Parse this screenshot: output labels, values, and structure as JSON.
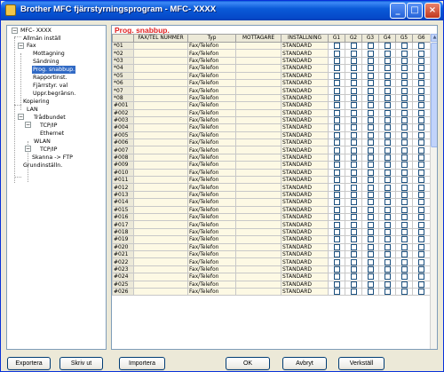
{
  "window": {
    "title": "Brother MFC fjärrstyrningsprogram - MFC-   XXXX"
  },
  "tree": {
    "items": [
      {
        "label": "MFC- XXXX"
      },
      {
        "label": "Allmän inställ"
      },
      {
        "label": "Fax"
      },
      {
        "label": "Mottagning"
      },
      {
        "label": "Sändning"
      },
      {
        "label": "Prog. snabbup."
      },
      {
        "label": "Rapportinst."
      },
      {
        "label": "Fjärrstyr. val"
      },
      {
        "label": "Uppr.begränsn."
      },
      {
        "label": "Kopiering"
      },
      {
        "label": "LAN"
      },
      {
        "label": "Trådbundet"
      },
      {
        "label": "TCP/IP"
      },
      {
        "label": "Ethernet"
      },
      {
        "label": "WLAN"
      },
      {
        "label": "TCP/IP"
      },
      {
        "label": "Skanna -> FTP"
      },
      {
        "label": "Grundinställn."
      }
    ],
    "selected": "Prog. snabbup."
  },
  "main": {
    "section_title": "Prog. snabbup.",
    "columns": [
      "",
      "FAX/TEL NUMMER",
      "Typ",
      "MOTTAGARE",
      "INSTÄLLNING",
      "G1",
      "G2",
      "G3",
      "G4",
      "G5",
      "G6"
    ],
    "rows": [
      {
        "id": "*01",
        "number": "",
        "type": "Fax/Telefon",
        "recipient": "",
        "setting": "STANDARD"
      },
      {
        "id": "*02",
        "number": "",
        "type": "Fax/Telefon",
        "recipient": "",
        "setting": "STANDARD"
      },
      {
        "id": "*03",
        "number": "",
        "type": "Fax/Telefon",
        "recipient": "",
        "setting": "STANDARD"
      },
      {
        "id": "*04",
        "number": "",
        "type": "Fax/Telefon",
        "recipient": "",
        "setting": "STANDARD"
      },
      {
        "id": "*05",
        "number": "",
        "type": "Fax/Telefon",
        "recipient": "",
        "setting": "STANDARD"
      },
      {
        "id": "*06",
        "number": "",
        "type": "Fax/Telefon",
        "recipient": "",
        "setting": "STANDARD"
      },
      {
        "id": "*07",
        "number": "",
        "type": "Fax/Telefon",
        "recipient": "",
        "setting": "STANDARD"
      },
      {
        "id": "*08",
        "number": "",
        "type": "Fax/Telefon",
        "recipient": "",
        "setting": "STANDARD"
      },
      {
        "id": "#001",
        "number": "",
        "type": "Fax/Telefon",
        "recipient": "",
        "setting": "STANDARD"
      },
      {
        "id": "#002",
        "number": "",
        "type": "Fax/Telefon",
        "recipient": "",
        "setting": "STANDARD"
      },
      {
        "id": "#003",
        "number": "",
        "type": "Fax/Telefon",
        "recipient": "",
        "setting": "STANDARD"
      },
      {
        "id": "#004",
        "number": "",
        "type": "Fax/Telefon",
        "recipient": "",
        "setting": "STANDARD"
      },
      {
        "id": "#005",
        "number": "",
        "type": "Fax/Telefon",
        "recipient": "",
        "setting": "STANDARD"
      },
      {
        "id": "#006",
        "number": "",
        "type": "Fax/Telefon",
        "recipient": "",
        "setting": "STANDARD"
      },
      {
        "id": "#007",
        "number": "",
        "type": "Fax/Telefon",
        "recipient": "",
        "setting": "STANDARD"
      },
      {
        "id": "#008",
        "number": "",
        "type": "Fax/Telefon",
        "recipient": "",
        "setting": "STANDARD"
      },
      {
        "id": "#009",
        "number": "",
        "type": "Fax/Telefon",
        "recipient": "",
        "setting": "STANDARD"
      },
      {
        "id": "#010",
        "number": "",
        "type": "Fax/Telefon",
        "recipient": "",
        "setting": "STANDARD"
      },
      {
        "id": "#011",
        "number": "",
        "type": "Fax/Telefon",
        "recipient": "",
        "setting": "STANDARD"
      },
      {
        "id": "#012",
        "number": "",
        "type": "Fax/Telefon",
        "recipient": "",
        "setting": "STANDARD"
      },
      {
        "id": "#013",
        "number": "",
        "type": "Fax/Telefon",
        "recipient": "",
        "setting": "STANDARD"
      },
      {
        "id": "#014",
        "number": "",
        "type": "Fax/Telefon",
        "recipient": "",
        "setting": "STANDARD"
      },
      {
        "id": "#015",
        "number": "",
        "type": "Fax/Telefon",
        "recipient": "",
        "setting": "STANDARD"
      },
      {
        "id": "#016",
        "number": "",
        "type": "Fax/Telefon",
        "recipient": "",
        "setting": "STANDARD"
      },
      {
        "id": "#017",
        "number": "",
        "type": "Fax/Telefon",
        "recipient": "",
        "setting": "STANDARD"
      },
      {
        "id": "#018",
        "number": "",
        "type": "Fax/Telefon",
        "recipient": "",
        "setting": "STANDARD"
      },
      {
        "id": "#019",
        "number": "",
        "type": "Fax/Telefon",
        "recipient": "",
        "setting": "STANDARD"
      },
      {
        "id": "#020",
        "number": "",
        "type": "Fax/Telefon",
        "recipient": "",
        "setting": "STANDARD"
      },
      {
        "id": "#021",
        "number": "",
        "type": "Fax/Telefon",
        "recipient": "",
        "setting": "STANDARD"
      },
      {
        "id": "#022",
        "number": "",
        "type": "Fax/Telefon",
        "recipient": "",
        "setting": "STANDARD"
      },
      {
        "id": "#023",
        "number": "",
        "type": "Fax/Telefon",
        "recipient": "",
        "setting": "STANDARD"
      },
      {
        "id": "#024",
        "number": "",
        "type": "Fax/Telefon",
        "recipient": "",
        "setting": "STANDARD"
      },
      {
        "id": "#025",
        "number": "",
        "type": "Fax/Telefon",
        "recipient": "",
        "setting": "STANDARD"
      },
      {
        "id": "#026",
        "number": "",
        "type": "Fax/Telefon",
        "recipient": "",
        "setting": "STANDARD"
      }
    ]
  },
  "buttons": {
    "export": "Exportera",
    "print": "Skriv ut",
    "import": "Importera",
    "ok": "OK",
    "cancel": "Avbryt",
    "apply": "Verkställ"
  },
  "colors": {
    "title_bar": "#0a5ad8",
    "selection": "#316ac5",
    "section_title": "#e02020",
    "row_background": "#fdf9e4"
  }
}
